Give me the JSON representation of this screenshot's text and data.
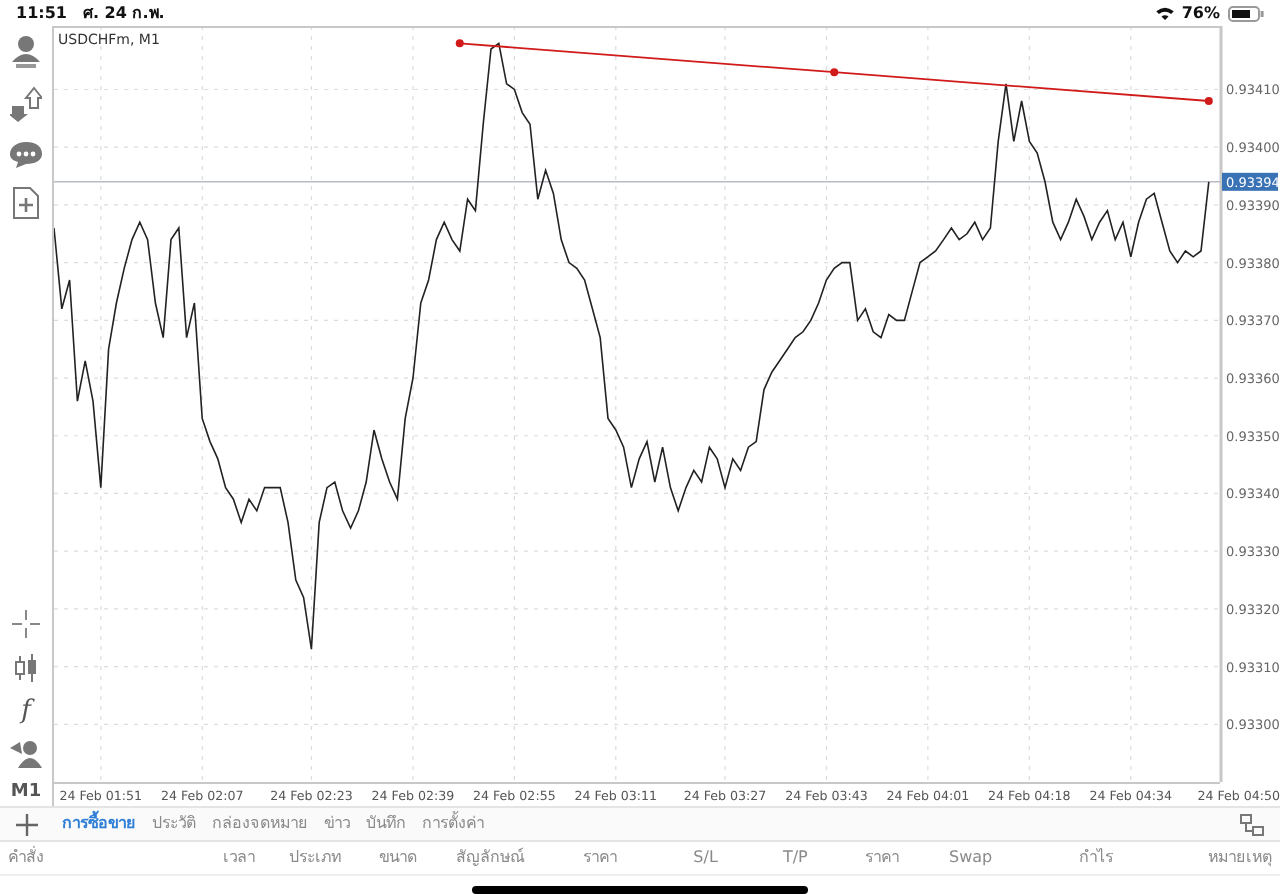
{
  "status_bar": {
    "time": "11:51",
    "date": "ศ. 24 ก.พ.",
    "battery": "76%"
  },
  "toolbar": {
    "indicator_glyph": "f",
    "timeframe": "M1"
  },
  "chart": {
    "title": "USDCHFm, M1",
    "chart_data": {
      "type": "line",
      "grid": true,
      "ylim": [
        0.9329,
        0.93421
      ],
      "yticks": [
        {
          "value": 0.933,
          "label": "0.93300"
        },
        {
          "value": 0.9331,
          "label": "0.93310"
        },
        {
          "value": 0.9332,
          "label": "0.93320"
        },
        {
          "value": 0.9333,
          "label": "0.93330"
        },
        {
          "value": 0.9334,
          "label": "0.93340"
        },
        {
          "value": 0.9335,
          "label": "0.93350"
        },
        {
          "value": 0.9336,
          "label": "0.93360"
        },
        {
          "value": 0.9337,
          "label": "0.93370"
        },
        {
          "value": 0.9338,
          "label": "0.93380"
        },
        {
          "value": 0.9339,
          "label": "0.93390"
        },
        {
          "value": 0.934,
          "label": "0.93400"
        },
        {
          "value": 0.9341,
          "label": "0.93410"
        }
      ],
      "categories": [
        null,
        null,
        null,
        null,
        null,
        null,
        "24 Feb 01:51",
        null,
        null,
        null,
        null,
        null,
        null,
        null,
        null,
        null,
        null,
        null,
        null,
        "24 Feb 02:07",
        null,
        null,
        null,
        null,
        null,
        null,
        null,
        null,
        null,
        null,
        null,
        null,
        null,
        "24 Feb 02:23",
        null,
        null,
        null,
        null,
        null,
        null,
        null,
        null,
        null,
        null,
        null,
        null,
        "24 Feb 02:39",
        null,
        null,
        null,
        null,
        null,
        null,
        null,
        null,
        null,
        null,
        null,
        null,
        "24 Feb 02:55",
        null,
        null,
        null,
        null,
        null,
        null,
        null,
        null,
        null,
        null,
        null,
        null,
        "24 Feb 03:11",
        null,
        null,
        null,
        null,
        null,
        null,
        null,
        null,
        null,
        null,
        null,
        null,
        null,
        "24 Feb 03:27",
        null,
        null,
        null,
        null,
        null,
        null,
        null,
        null,
        null,
        null,
        null,
        null,
        "24 Feb 03:43",
        null,
        null,
        null,
        null,
        null,
        null,
        null,
        null,
        null,
        null,
        null,
        null,
        "24 Feb 04:01",
        null,
        null,
        null,
        null,
        null,
        null,
        null,
        null,
        null,
        null,
        null,
        null,
        "24 Feb 04:18",
        null,
        null,
        null,
        null,
        null,
        null,
        null,
        null,
        null,
        null,
        null,
        null,
        "24 Feb 04:34",
        null,
        null,
        null,
        null,
        null,
        null,
        null,
        null,
        null,
        null,
        null,
        null,
        null,
        "24 Feb 04:50"
      ],
      "series": [
        {
          "color": "#222222",
          "values": [
            0.93386,
            0.93372,
            0.93377,
            0.93356,
            0.93363,
            0.93356,
            0.93341,
            0.93365,
            0.93373,
            0.93379,
            0.93384,
            0.93387,
            0.93384,
            0.93373,
            0.93367,
            0.93384,
            0.93386,
            0.93367,
            0.93373,
            0.93353,
            0.93349,
            0.93346,
            0.93341,
            0.93339,
            0.93335,
            0.93339,
            0.93337,
            0.93341,
            0.93341,
            0.93341,
            0.93335,
            0.93325,
            0.93322,
            0.93313,
            0.93335,
            0.93341,
            0.93342,
            0.93337,
            0.93334,
            0.93337,
            0.93342,
            0.93351,
            0.93346,
            0.93342,
            0.93339,
            0.93353,
            0.9336,
            0.93373,
            0.93377,
            0.93384,
            0.93387,
            0.93384,
            0.93382,
            0.93391,
            0.93389,
            0.93404,
            0.93417,
            0.93418,
            0.93411,
            0.9341,
            0.93406,
            0.93404,
            0.93391,
            0.93396,
            0.93392,
            0.93384,
            0.9338,
            0.93379,
            0.93377,
            0.93372,
            0.93367,
            0.93353,
            0.93351,
            0.93348,
            0.93341,
            0.93346,
            0.93349,
            0.93342,
            0.93348,
            0.93341,
            0.93337,
            0.93341,
            0.93344,
            0.93342,
            0.93348,
            0.93346,
            0.93341,
            0.93346,
            0.93344,
            0.93348,
            0.93349,
            0.93358,
            0.93361,
            0.93363,
            0.93365,
            0.93367,
            0.93368,
            0.9337,
            0.93373,
            0.93377,
            0.93379,
            0.9338,
            0.9338,
            0.9337,
            0.93372,
            0.93368,
            0.93367,
            0.93371,
            0.9337,
            0.9337,
            0.93375,
            0.9338,
            0.93381,
            0.93382,
            0.93384,
            0.93386,
            0.93384,
            0.93385,
            0.93387,
            0.93384,
            0.93386,
            0.93401,
            0.93411,
            0.93401,
            0.93408,
            0.93401,
            0.93399,
            0.93394,
            0.93387,
            0.93384,
            0.93387,
            0.93391,
            0.93388,
            0.93384,
            0.93387,
            0.93389,
            0.93384,
            0.93387,
            0.93381,
            0.93387,
            0.93391,
            0.93392,
            0.93387,
            0.93382,
            0.9338,
            0.93382,
            0.93381,
            0.93382,
            0.93394,
            null,
            null,
            null,
            null
          ]
        },
        {
          "color": "#d11a1a",
          "marker": true,
          "values": [
            null,
            null,
            null,
            null,
            null,
            null,
            null,
            null,
            null,
            null,
            null,
            null,
            null,
            null,
            null,
            null,
            null,
            null,
            null,
            null,
            null,
            null,
            null,
            null,
            null,
            null,
            null,
            null,
            null,
            null,
            null,
            null,
            null,
            null,
            null,
            null,
            null,
            null,
            null,
            null,
            null,
            null,
            null,
            null,
            null,
            null,
            null,
            null,
            null,
            null,
            null,
            null,
            0.93418,
            null,
            null,
            null,
            null,
            null,
            null,
            null,
            null,
            null,
            null,
            null,
            null,
            null,
            null,
            null,
            null,
            null,
            null,
            null,
            null,
            null,
            null,
            null,
            null,
            null,
            null,
            null,
            null,
            null,
            null,
            null,
            null,
            null,
            null,
            null,
            null,
            null,
            null,
            null,
            null,
            null,
            null,
            null,
            null,
            null,
            null,
            null,
            0.93413,
            null,
            null,
            null,
            null,
            null,
            null,
            null,
            null,
            null,
            null,
            null,
            null,
            null,
            null,
            null,
            null,
            null,
            null,
            null,
            null,
            null,
            null,
            null,
            null,
            null,
            null,
            null,
            null,
            null,
            null,
            null,
            null,
            null,
            null,
            null,
            null,
            null,
            null,
            null,
            null,
            null,
            null,
            null,
            null,
            null,
            null,
            null,
            0.93408,
            null,
            null,
            null,
            null
          ]
        }
      ],
      "ref_lines": [
        {
          "axis": "y",
          "value": 0.93394,
          "label": "0.93394"
        }
      ]
    }
  },
  "tabs": [
    {
      "label": "การซื้อขาย",
      "selected": true
    },
    {
      "label": "ประวัติ",
      "selected": false
    },
    {
      "label": "กล่องจดหมาย",
      "selected": false
    },
    {
      "label": "ข่าว",
      "selected": false
    },
    {
      "label": "บันทึก",
      "selected": false
    },
    {
      "label": "การตั้งค่า",
      "selected": false
    }
  ],
  "table": {
    "columns": [
      "คำสั่ง",
      "เวลา",
      "ประเภท",
      "ขนาด",
      "สัญลักษณ์",
      "ราคา",
      "S/L",
      "T/P",
      "ราคา",
      "Swap",
      "กำไร",
      "หมายเหตุ"
    ]
  }
}
